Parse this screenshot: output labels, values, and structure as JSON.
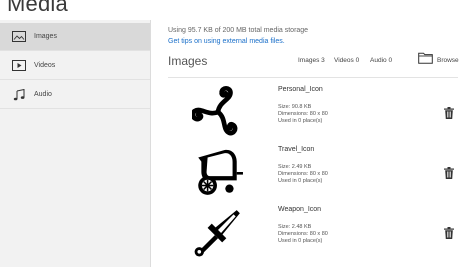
{
  "app": {
    "title": "Media"
  },
  "sidebar": {
    "items": [
      {
        "label": "Images",
        "icon": "image-icon",
        "active": true
      },
      {
        "label": "Videos",
        "icon": "video-icon",
        "active": false
      },
      {
        "label": "Audio",
        "icon": "music-note-icon",
        "active": false
      }
    ]
  },
  "storage": {
    "usage_text": "Using 95.7 KB of 200 MB total media storage",
    "tips_link": "Get tips on using external media files."
  },
  "section": {
    "title": "Images",
    "counts": [
      {
        "label": "Images",
        "value": "3"
      },
      {
        "label": "Videos",
        "value": "0"
      },
      {
        "label": "Audio",
        "value": "0"
      }
    ],
    "browse_label": "Browse",
    "browse_icon": "folder-icon"
  },
  "media_items": [
    {
      "name": "Personal_Icon",
      "size": "Size: 90.8 KB",
      "dimensions": "Dimensions: 80 x 80",
      "used_in": "Used in 0 place(s)",
      "icon": "triskelion-icon"
    },
    {
      "name": "Travel_Icon",
      "size": "Size: 2.49 KB",
      "dimensions": "Dimensions: 80 x 80",
      "used_in": "Used in 0 place(s)",
      "icon": "carriage-icon"
    },
    {
      "name": "Weapon_Icon",
      "size": "Size: 2.48 KB",
      "dimensions": "Dimensions: 80 x 80",
      "used_in": "Used in 0 place(s)",
      "icon": "sword-icon"
    }
  ],
  "colors": {
    "link": "#1a6fc9",
    "sidebar_bg": "#f2f2f2",
    "sidebar_active": "#d9d9d9"
  }
}
